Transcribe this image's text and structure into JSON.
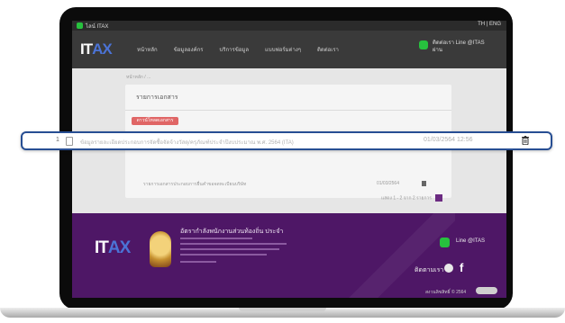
{
  "topbar": {
    "badge_text": "ไลน์ ITAX",
    "right_text": "TH | ENG"
  },
  "nav": {
    "logo_a": "IT",
    "logo_b": "AX",
    "items": [
      "หน้าหลัก",
      "ข้อมูลองค์กร",
      "บริการข้อมูล",
      "แบบฟอร์มต่างๆ",
      "ติดต่อเรา"
    ],
    "line_text_1": "ติดต่อเรา Line @ITAS",
    "line_text_2": "ผ่าน"
  },
  "content": {
    "breadcrumb": "หน้าหลัก / ...",
    "card_title": "รายการเอกสาร",
    "red_tag": "ดาวน์โหลดเอกสาร",
    "dim_row_text": "รายการเอกสารประกอบการยื่นคำขอจดทะเบียนบริษัท",
    "dim_row_date": "01/03/2564",
    "pager_text": "แสดง 1 - 2 จาก 2 รายการ",
    "pager_page": "1"
  },
  "row": {
    "number": "1",
    "description": "ข้อมูลรายละเอียดประกอบการจัดซื้อจัดจ้างวัสดุ/ครุภัณฑ์ประจำปีงบประมาณ พ.ศ. 2564 (ITA)",
    "date": "01/03/2564 12:56"
  },
  "footer": {
    "title": "อัตรากำลังพนักงานส่วนท้องถิ่น ประจำ",
    "line_text": "Line @ITAS",
    "follow": "ติดตามเรา",
    "bottom_text": "สงวนลิขสิทธิ์ © 2564"
  },
  "colors": {
    "accent": "#274e93",
    "brand_purple": "#4e1766",
    "line_green": "#27c13e"
  }
}
